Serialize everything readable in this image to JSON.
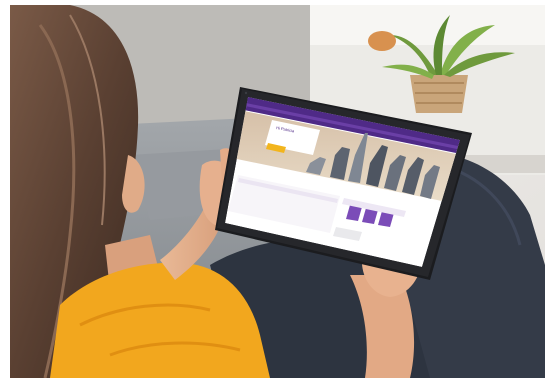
{
  "colors": {
    "brand_purple": "#4f2a87",
    "accent_purple": "#7b4cb8",
    "sweater_yellow": "#f2a71e",
    "sofa_grey": "#8f9499",
    "wall_light": "#f1efec",
    "jeans_dark": "#2d3440"
  },
  "tablet": {
    "brand_name": "",
    "greeting": "Hi Patricia",
    "hero_button": "",
    "panel_title": "",
    "updates_title": ""
  },
  "icons": [
    "brand-logo-icon",
    "account-icon",
    "document-icon"
  ]
}
